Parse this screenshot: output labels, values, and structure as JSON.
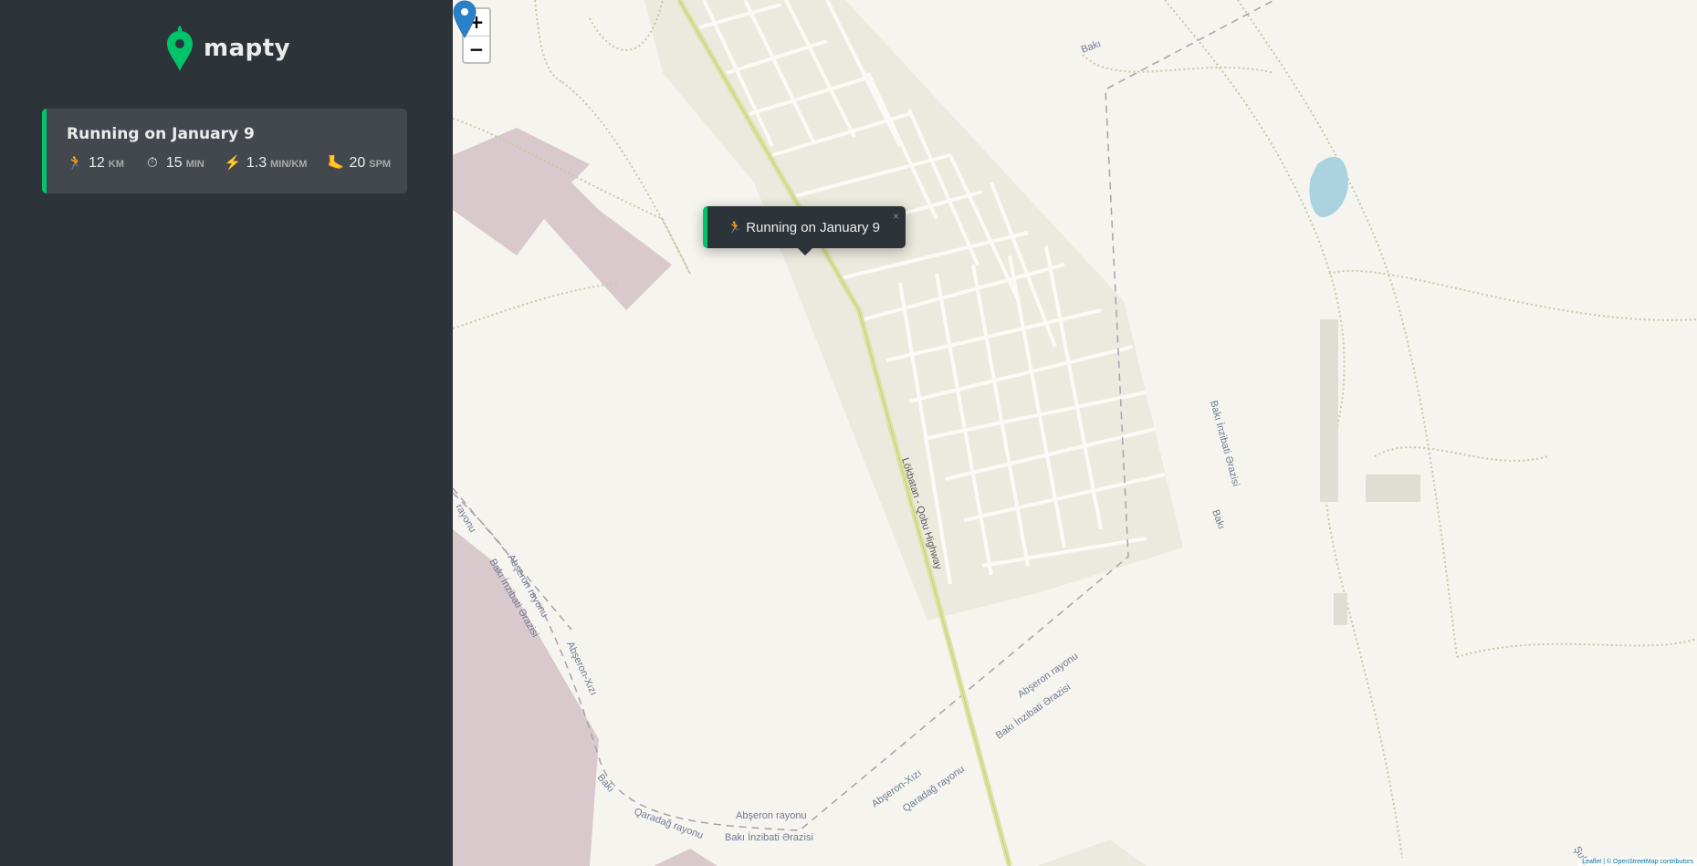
{
  "app": {
    "name": "mapty"
  },
  "workouts": [
    {
      "title": "Running on January 9",
      "details": [
        {
          "icon": "🏃",
          "icon_name": "runner-icon",
          "value": "12",
          "unit": "km"
        },
        {
          "icon": "⏱",
          "icon_name": "stopwatch-icon",
          "value": "15",
          "unit": "min"
        },
        {
          "icon": "⚡",
          "icon_name": "lightning-icon",
          "value": "1.3",
          "unit": "min/km"
        },
        {
          "icon": "🦶",
          "icon_name": "foot-icon",
          "value": "20",
          "unit": "spm"
        }
      ]
    }
  ],
  "map": {
    "zoom_in": "+",
    "zoom_out": "−",
    "popup": {
      "icon": "🏃",
      "text": "Running on January 9",
      "close": "×"
    },
    "labels": {
      "highway": "Lökbatan - Qobu Highway",
      "baki_top": "Bakı",
      "baki_inzibati_vertical": "Bakı İnzibati Ərazisi",
      "baki_right": "Bakı",
      "rayonu_left": "rayonu",
      "abseron_rayonu_left": "Abşeron rayonu",
      "baki_inzibati_left": "Bakı İnzibati Ərazisi",
      "abseron_xizi_left": "Abşeron-Xızı",
      "baki_bottom_left": "Bakı",
      "qaradag_bottom": "Qaradağ rayonu",
      "abseron_rayonu_bottom": "Abşeron rayonu",
      "baki_inzibati_bottom": "Bakı İnzibati Ərazisi",
      "abseron_xizi_bottom": "Abşeron-Xızı",
      "qaradag_bottom2": "Qaradağ rayonu",
      "abseron_rayonu_mid": "Abşeron rayonu",
      "baki_inzibati_mid": "Bakı İnzibati Ərazisi",
      "sulu_corner": "Şulu"
    },
    "attribution": "Leaflet | © OpenStreetMap contributors"
  },
  "colors": {
    "accent_running": "#00c46a",
    "sidebar_bg": "#2d3439",
    "card_bg": "#42484d",
    "map_bg": "#f2efe9",
    "marker": "#2a81cb"
  }
}
